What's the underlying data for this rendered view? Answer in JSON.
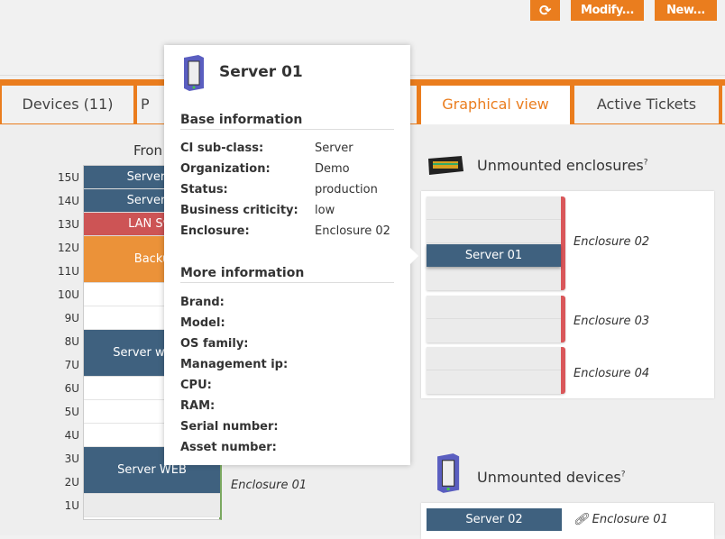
{
  "toolbar": {
    "refresh_icon": "refresh-icon",
    "modify_label": "Modify...",
    "new_label": "New..."
  },
  "tabs": [
    {
      "label": "Devices (11)"
    },
    {
      "label": "P"
    },
    {
      "label": "Graphical view",
      "active": true
    },
    {
      "label": "Active Tickets"
    }
  ],
  "rack": {
    "title": "Fron",
    "units": [
      "15U",
      "14U",
      "13U",
      "12U",
      "11U",
      "10U",
      "9U",
      "8U",
      "7U",
      "6U",
      "5U",
      "4U",
      "3U",
      "2U",
      "1U"
    ],
    "devices": [
      {
        "label": "Server C",
        "color": "#3f617f"
      },
      {
        "label": "Server B",
        "color": "#3f617f"
      },
      {
        "label": "LAN Swi",
        "color": "#cd5455"
      },
      {
        "label": "Backu",
        "color": "#eb9239"
      },
      {
        "label": "Server with a",
        "color": "#3f617f"
      },
      {
        "label": "Server WEB",
        "color": "#3f617f"
      }
    ],
    "enclosure_label": "Enclosure 01"
  },
  "tooltip": {
    "title": "Server 01",
    "base_heading": "Base information",
    "base": [
      {
        "label": "CI sub-class:",
        "value": "Server"
      },
      {
        "label": "Organization:",
        "value": "Demo"
      },
      {
        "label": "Status:",
        "value": "production"
      },
      {
        "label": "Business criticity:",
        "value": "low"
      },
      {
        "label": "Enclosure:",
        "value": "Enclosure 02"
      }
    ],
    "more_heading": "More information",
    "more": [
      {
        "label": "Brand:"
      },
      {
        "label": "Model:"
      },
      {
        "label": "OS family:"
      },
      {
        "label": "Management ip:"
      },
      {
        "label": "CPU:"
      },
      {
        "label": "RAM:"
      },
      {
        "label": "Serial number:"
      },
      {
        "label": "Asset number:"
      }
    ]
  },
  "unmounted_enclosures": {
    "title": "Unmounted enclosures",
    "help": "?",
    "items": [
      {
        "name": "Enclosure 02",
        "device": "Server 01"
      },
      {
        "name": "Enclosure 03"
      },
      {
        "name": "Enclosure 04"
      }
    ]
  },
  "unmounted_devices": {
    "title": "Unmounted devices",
    "help": "?",
    "items": [
      {
        "device": "Server 02",
        "enclosure": "Enclosure 01"
      }
    ]
  },
  "colors": {
    "accent": "#ea7d1e",
    "device": "#3f617f",
    "enclosure_bar": "#d9575a",
    "rack_bar": "#7aa860"
  }
}
